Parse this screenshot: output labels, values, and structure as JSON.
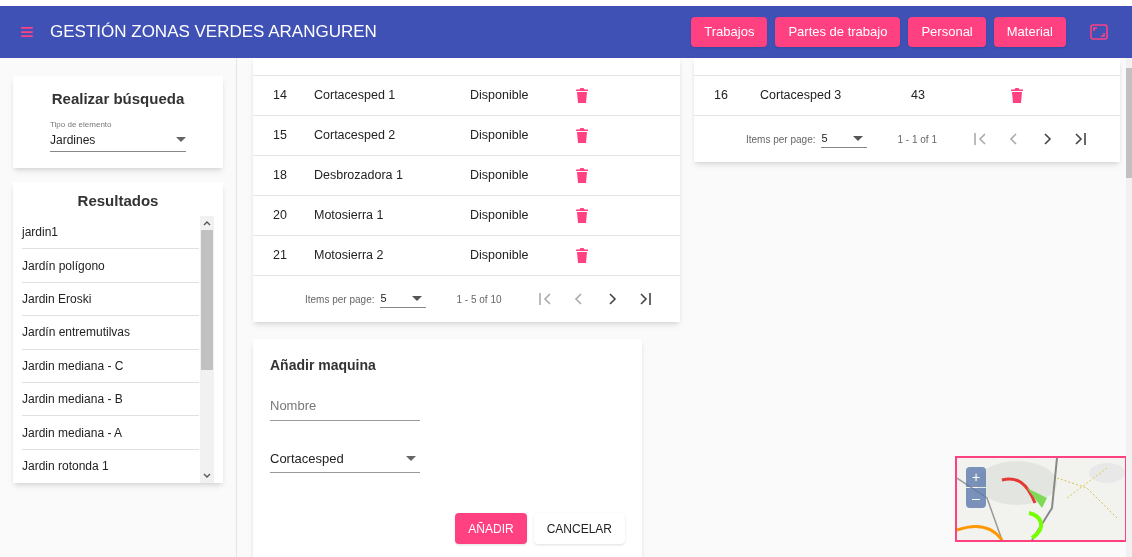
{
  "app_bar": {
    "menu_glyph": "≡",
    "title": "GESTIÓN ZONAS VERDES ARANGUREN",
    "nav_buttons": [
      "Trabajos",
      "Partes de trabajo",
      "Personal",
      "Material"
    ]
  },
  "search_card": {
    "title": "Realizar búsqueda",
    "field_label": "Tipo de elemento",
    "field_value": "Jardines"
  },
  "results_card": {
    "title": "Resultados",
    "items": [
      "jardin1",
      "Jardín polígono",
      "Jardin Eroski",
      "Jardín entremutilvas",
      "Jardin mediana - C",
      "Jardin mediana - B",
      "Jardin mediana - A",
      "Jardin rotonda 1"
    ]
  },
  "machines_table": {
    "rows": [
      {
        "id": "14",
        "name": "Cortacesped 1",
        "column_3": "Disponible"
      },
      {
        "id": "15",
        "name": "Cortacesped 2",
        "column_3": "Disponible"
      },
      {
        "id": "18",
        "name": "Desbrozadora 1",
        "column_3": "Disponible"
      },
      {
        "id": "20",
        "name": "Motosierra 1",
        "column_3": "Disponible"
      },
      {
        "id": "21",
        "name": "Motosierra 2",
        "column_3": "Disponible"
      }
    ],
    "paginator": {
      "label": "Items per page:",
      "page_size": "5",
      "range": "1 - 5 of 10"
    }
  },
  "second_table": {
    "rows": [
      {
        "id": "16",
        "name": "Cortacesped 3",
        "column_3": "43"
      }
    ],
    "paginator": {
      "label": "Items per page:",
      "page_size": "5",
      "range": "1 - 1 of 1"
    }
  },
  "add_form": {
    "title": "Añadir maquina",
    "name_placeholder": "Nombre",
    "type_value": "Cortacesped",
    "buttons": [
      "AÑADIR",
      "CANCELAR"
    ]
  },
  "map": {
    "zoom_in": "+",
    "zoom_out": "–"
  }
}
